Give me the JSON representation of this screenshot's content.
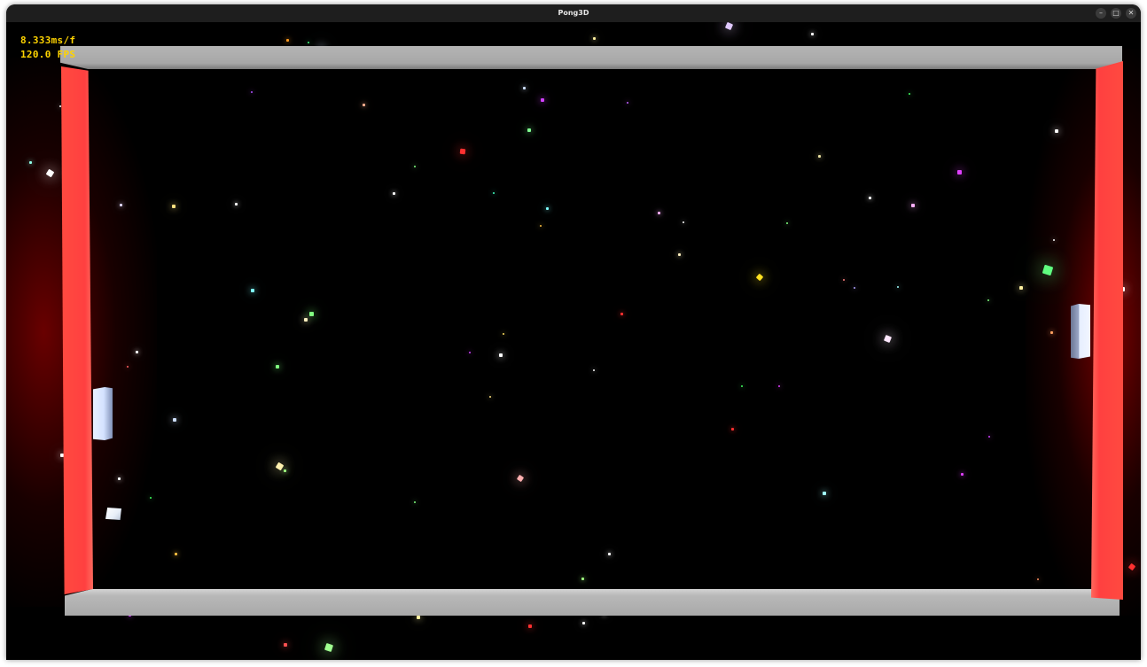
{
  "window": {
    "title": "Pong3D",
    "controls": {
      "minimize_glyph": "–",
      "maximize_glyph": "□",
      "close_glyph": "✕"
    }
  },
  "hud": {
    "frame_time": "8.333ms/f",
    "fps": "120.0 FPS"
  },
  "colors": {
    "background": "#000000",
    "goal": "#ff4040",
    "wall": "#a8a8a8",
    "paddle": "#dde8ff",
    "ball": "#f4f8ff",
    "hud_text": "#ffd400",
    "titlebar": "#1e1e1e"
  }
}
